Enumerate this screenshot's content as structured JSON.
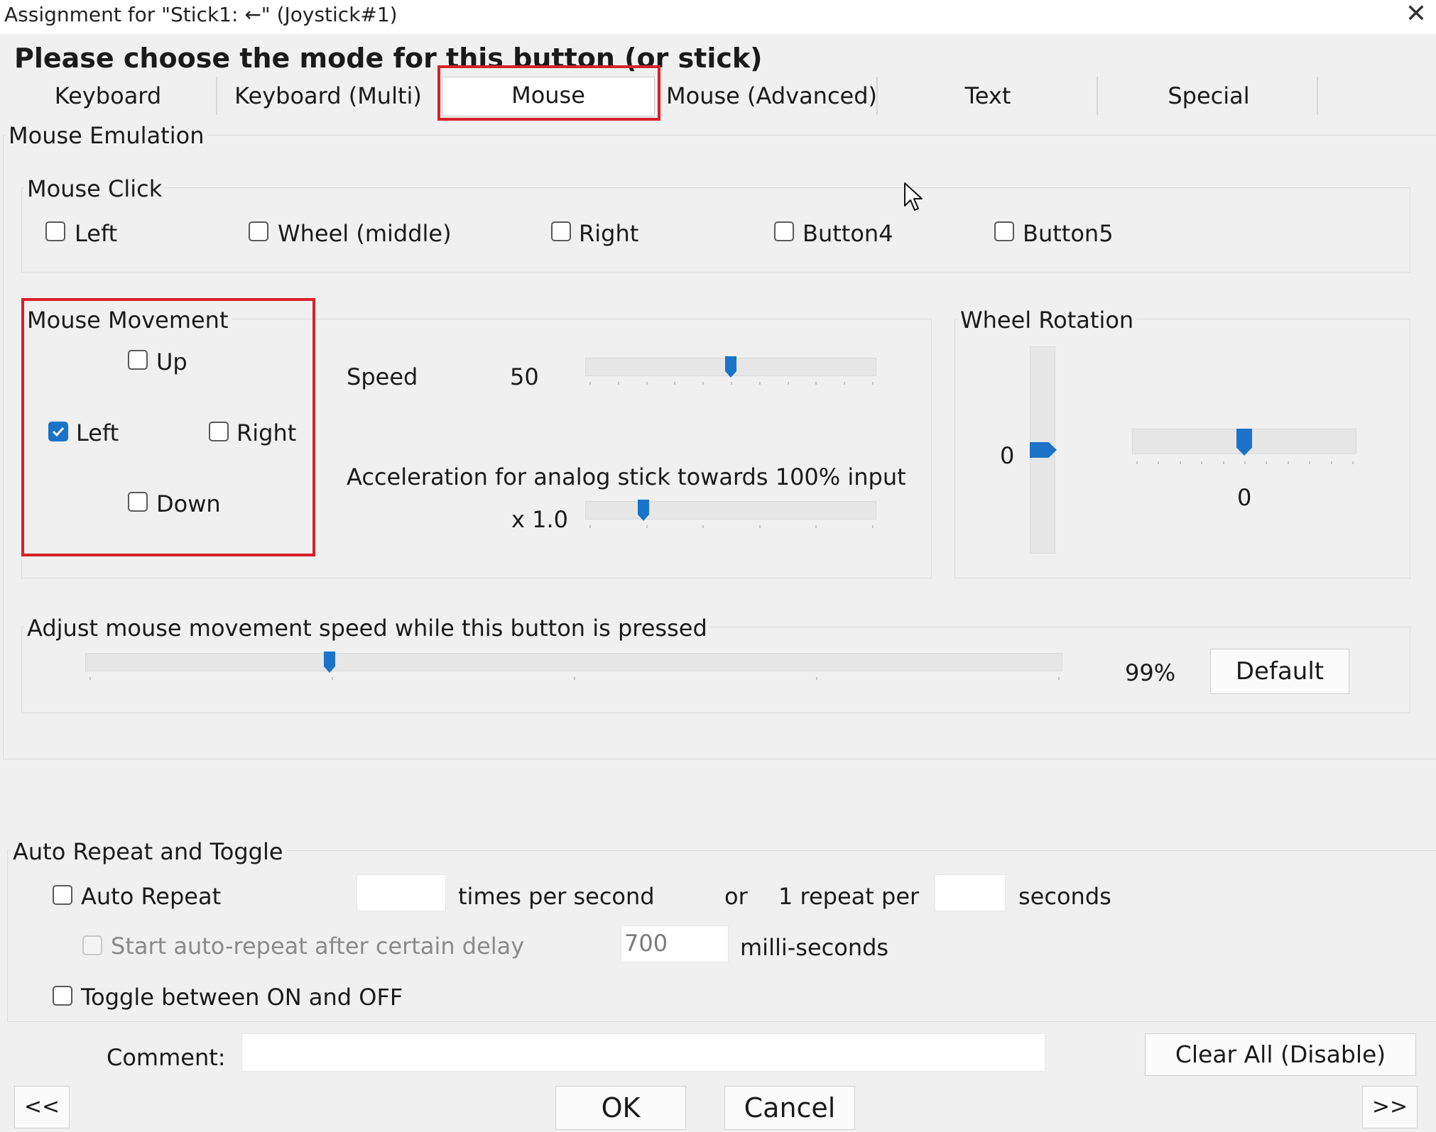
{
  "window": {
    "title": "Assignment for \"Stick1: ←\" (Joystick#1)",
    "close_glyph": "✕"
  },
  "heading": "Please choose the mode for this button (or stick)",
  "tabs": [
    "Keyboard",
    "Keyboard (Multi)",
    "Mouse",
    "Mouse (Advanced)",
    "Text",
    "Special"
  ],
  "active_tab": "Mouse",
  "mouse_emulation": {
    "label": "Mouse Emulation",
    "click": {
      "label": "Mouse Click",
      "options": [
        {
          "label": "Left",
          "checked": false
        },
        {
          "label": "Wheel (middle)",
          "checked": false
        },
        {
          "label": "Right",
          "checked": false
        },
        {
          "label": "Button4",
          "checked": false
        },
        {
          "label": "Button5",
          "checked": false
        }
      ]
    },
    "movement": {
      "label": "Mouse Movement",
      "up": {
        "label": "Up",
        "checked": false
      },
      "left": {
        "label": "Left",
        "checked": true
      },
      "right": {
        "label": "Right",
        "checked": false
      },
      "down": {
        "label": "Down",
        "checked": false
      }
    },
    "speed": {
      "label": "Speed",
      "value": "50",
      "fraction": 0.5
    },
    "acceleration": {
      "label": "Acceleration for analog stick towards 100% input",
      "value": "x 1.0",
      "fraction": 0.2
    },
    "wheel": {
      "label": "Wheel Rotation",
      "vertical_value": "0",
      "horizontal_value": "0",
      "fraction": 0.5
    },
    "adjust": {
      "label": "Adjust mouse movement speed while this button is pressed",
      "value": "99%",
      "fraction": 0.25,
      "default_button": "Default"
    }
  },
  "auto_repeat": {
    "label": "Auto Repeat and Toggle",
    "auto_repeat": {
      "label": "Auto Repeat",
      "checked": false
    },
    "times_per_second_label": "times per second",
    "times_per_second_value": "",
    "or_label": "or",
    "repeat_per_label": "1 repeat per",
    "seconds_value": "",
    "seconds_label": "seconds",
    "delay": {
      "label": "Start auto-repeat after certain delay",
      "checked": false,
      "value": "700",
      "unit": "milli-seconds"
    },
    "toggle": {
      "label": "Toggle between ON and OFF",
      "checked": false
    }
  },
  "comment": {
    "label": "Comment:",
    "value": ""
  },
  "buttons": {
    "clear_all": "Clear All (Disable)",
    "ok": "OK",
    "cancel": "Cancel",
    "prev": "<<",
    "next": ">>"
  },
  "colors": {
    "accent": "#1a73c8",
    "highlight": "#d8202a"
  }
}
